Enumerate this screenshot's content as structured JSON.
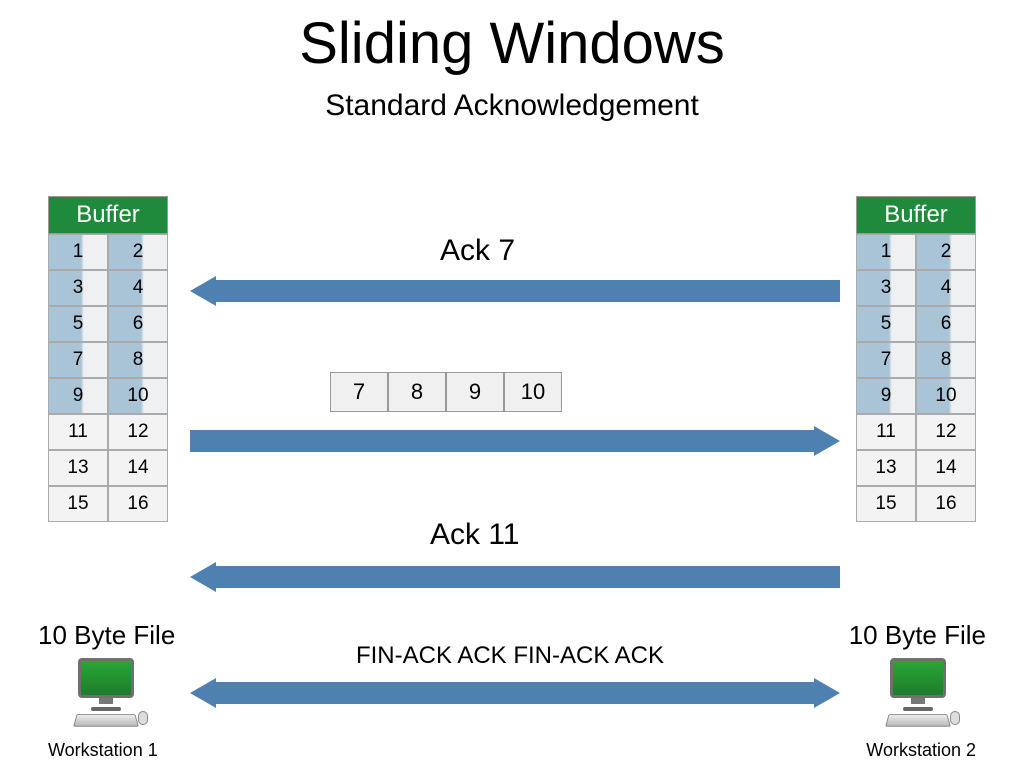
{
  "title": "Sliding Windows",
  "subtitle": "Standard Acknowledgement",
  "buffer_header": "Buffer",
  "buffer_cells": [
    "1",
    "2",
    "3",
    "4",
    "5",
    "6",
    "7",
    "8",
    "9",
    "10",
    "11",
    "12",
    "13",
    "14",
    "15",
    "16"
  ],
  "shaded_rows_left": [
    0,
    1,
    2,
    3,
    4
  ],
  "shaded_rows_right": [
    0,
    1,
    2,
    3,
    4
  ],
  "ack1_label": "Ack 7",
  "packets": [
    "7",
    "8",
    "9",
    "10"
  ],
  "ack2_label": "Ack 11",
  "finack_label": "FIN-ACK ACK FIN-ACK ACK",
  "file_label": "10 Byte File",
  "ws1_label": "Workstation 1",
  "ws2_label": "Workstation 2"
}
